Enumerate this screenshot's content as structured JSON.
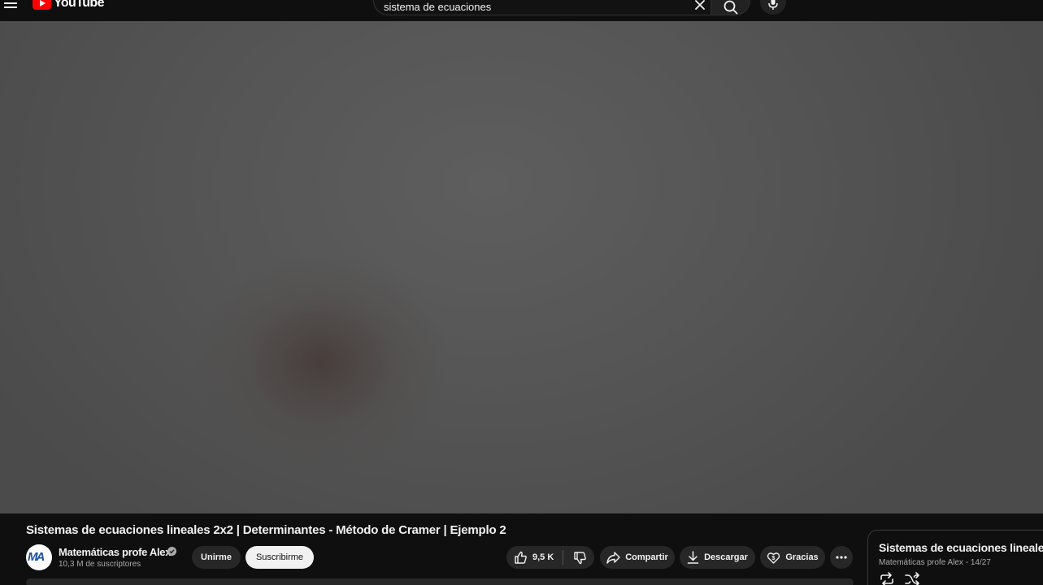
{
  "header": {
    "logo_text": "YouTube",
    "search_value": "sistema de ecuaciones"
  },
  "video": {
    "title": "Sistemas de ecuaciones lineales 2x2 | Determinantes - Método de Cramer | Ejemplo 2"
  },
  "channel": {
    "avatar_text": "MA",
    "name": "Matemáticas profe Alex",
    "subscribers": "10,3 M de suscriptores",
    "join_label": "Unirme",
    "subscribe_label": "Suscribirme"
  },
  "actions": {
    "likes": "9,5 K",
    "share_label": "Compartir",
    "download_label": "Descargar",
    "thanks_label": "Gracias"
  },
  "playlist": {
    "title": "Sistemas de ecuaciones lineales",
    "subtitle": "Matemáticas profe Alex - 14/27"
  },
  "colors": {
    "brand_red": "#ff0000",
    "background": "#0f0f0f",
    "pill": "#272727",
    "subscribe_bg": "#f1f1f1"
  },
  "icons": [
    "menu-icon",
    "youtube-logo-icon",
    "clear-icon",
    "search-icon",
    "mic-icon",
    "verified-icon",
    "like-icon",
    "dislike-icon",
    "share-icon",
    "download-icon",
    "thanks-icon",
    "more-icon",
    "loop-icon",
    "shuffle-icon"
  ]
}
